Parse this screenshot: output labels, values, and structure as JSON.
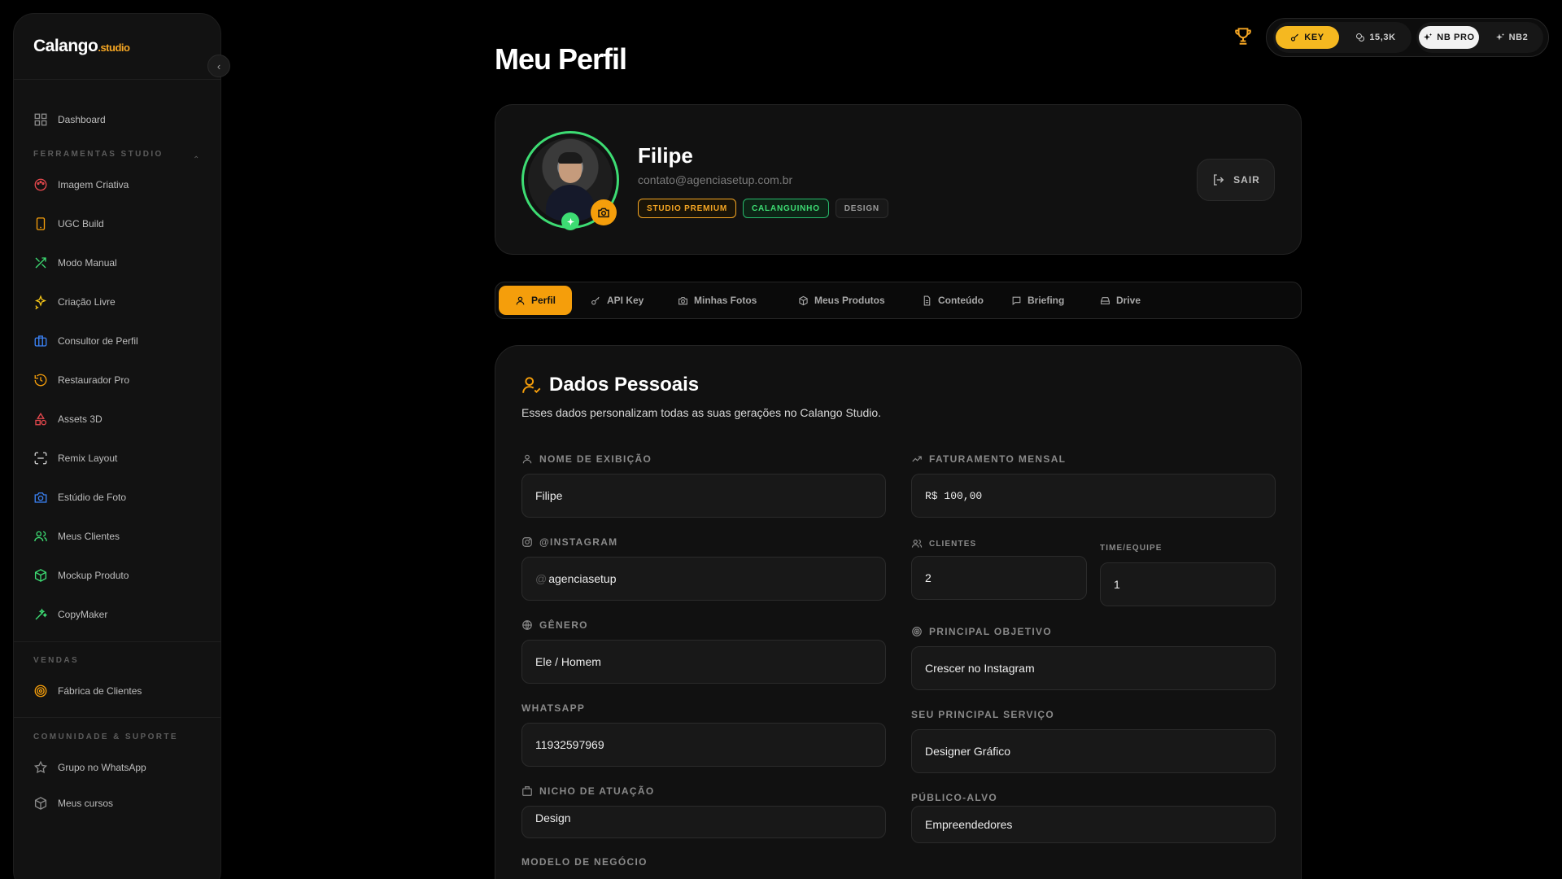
{
  "app": {
    "logo_main": "Calango",
    "logo_suffix": ".studio"
  },
  "sidebar": {
    "dashboard": "Dashboard",
    "section_tools": "FERRAMENTAS STUDIO",
    "tools": [
      {
        "label": "Imagem Criativa",
        "icon": "palette-icon",
        "color": "#e5484d"
      },
      {
        "label": "UGC Build",
        "icon": "smartphone-icon",
        "color": "#f59e0b"
      },
      {
        "label": "Modo Manual",
        "icon": "tools-icon",
        "color": "#3ddc73"
      },
      {
        "label": "Criação Livre",
        "icon": "sparkles-icon",
        "color": "#f5c518"
      },
      {
        "label": "Consultor de Perfil",
        "icon": "briefcase-icon",
        "color": "#3b82f6"
      },
      {
        "label": "Restaurador Pro",
        "icon": "history-icon",
        "color": "#f59e0b"
      },
      {
        "label": "Assets 3D",
        "icon": "shapes-icon",
        "color": "#e5484d"
      },
      {
        "label": "Remix Layout",
        "icon": "scan-icon",
        "color": "#cfcfcf"
      },
      {
        "label": "Estúdio de Foto",
        "icon": "camera-icon",
        "color": "#3b82f6"
      },
      {
        "label": "Meus Clientes",
        "icon": "users-icon",
        "color": "#3ddc73"
      },
      {
        "label": "Mockup Produto",
        "icon": "box-icon",
        "color": "#3ddc73"
      },
      {
        "label": "CopyMaker",
        "icon": "wand-icon",
        "color": "#3ddc73"
      }
    ],
    "section_sales": "VENDAS",
    "sales": [
      {
        "label": "Fábrica de Clientes",
        "icon": "target-icon",
        "color": "#f59e0b"
      }
    ],
    "section_community": "COMUNIDADE & SUPORTE",
    "community": [
      {
        "label": "Grupo no WhatsApp",
        "icon": "star-icon"
      },
      {
        "label": "Meus cursos",
        "icon": "box-icon"
      }
    ]
  },
  "topbar": {
    "key_label": "KEY",
    "credits": "15,3K",
    "nb_pro": "NB PRO",
    "nb2": "NB2"
  },
  "page": {
    "title": "Meu Perfil"
  },
  "profile": {
    "name": "Filipe",
    "email": "contato@agenciasetup.com.br",
    "badges": [
      "STUDIO PREMIUM",
      "CALANGUINHO",
      "DESIGN"
    ],
    "logout": "SAIR"
  },
  "tabs": [
    "Perfil",
    "API Key",
    "Minhas Fotos",
    "Meus Produtos",
    "Conteúdo",
    "Briefing",
    "Drive"
  ],
  "personal": {
    "title": "Dados Pessoais",
    "description": "Esses dados personalizam todas as suas gerações no Calango Studio.",
    "display_name_label": "NOME DE EXIBIÇÃO",
    "display_name": "Filipe",
    "revenue_label": "FATURAMENTO MENSAL",
    "revenue": "R$ 100,00",
    "instagram_label": "@INSTAGRAM",
    "instagram_prefix": "@",
    "instagram": "agenciasetup",
    "clients_label": "CLIENTES",
    "clients": "2",
    "team_label": "TIME/EQUIPE",
    "team": "1",
    "gender_label": "GÊNERO",
    "gender": "Ele / Homem",
    "goal_label": "PRINCIPAL OBJETIVO",
    "goal": "Crescer no Instagram",
    "whatsapp_label": "WHATSAPP",
    "whatsapp": "11932597969",
    "service_label": "SEU PRINCIPAL SERVIÇO",
    "service": "Designer Gráfico",
    "niche_label": "NICHO DE ATUAÇÃO",
    "niche": "Design",
    "audience_label": "PÚBLICO-ALVO",
    "audience": "Empreendedores",
    "business_label": "MODELO DE NEGÓCIO"
  }
}
